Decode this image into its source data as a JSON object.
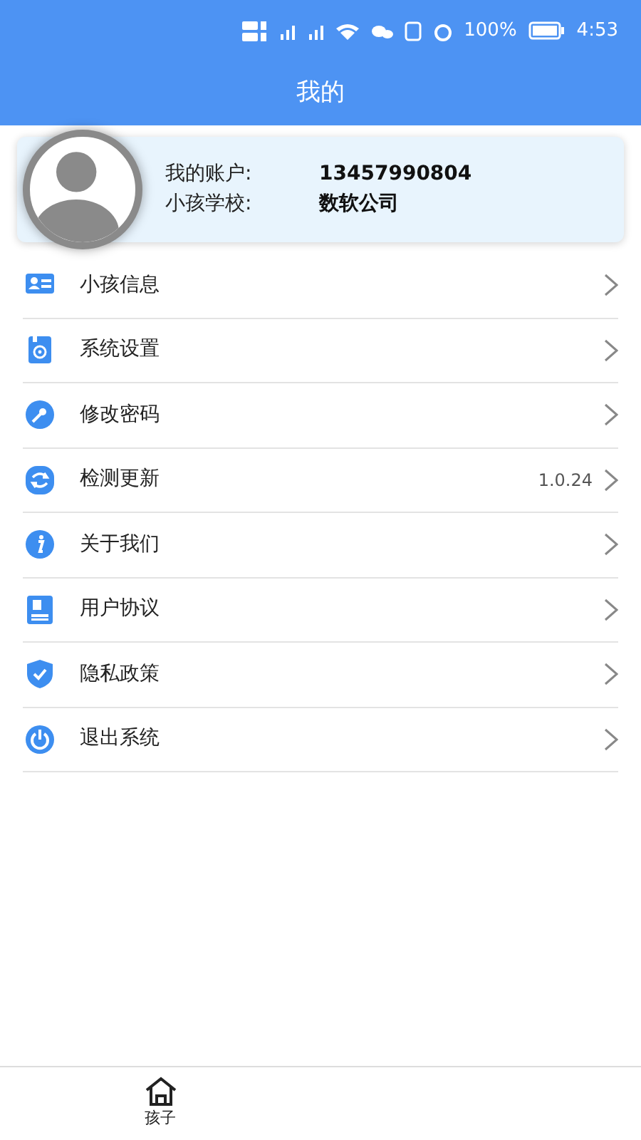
{
  "status_bar": {
    "battery": "100%",
    "time": "4:53"
  },
  "header": {
    "title": "我的"
  },
  "profile": {
    "rows": [
      {
        "label": "我的账户:",
        "value": "13457990804"
      },
      {
        "label": "小孩学校:",
        "value": "数软公司"
      }
    ]
  },
  "menu": [
    {
      "label": "小孩信息"
    },
    {
      "label": "系统设置"
    },
    {
      "label": "修改密码"
    },
    {
      "label": "检测更新",
      "value": "1.0.24"
    },
    {
      "label": "关于我们"
    },
    {
      "label": "用户协议"
    },
    {
      "label": "隐私政策"
    },
    {
      "label": "退出系统"
    }
  ],
  "tab_bar": [
    {
      "label": "孩子"
    }
  ]
}
